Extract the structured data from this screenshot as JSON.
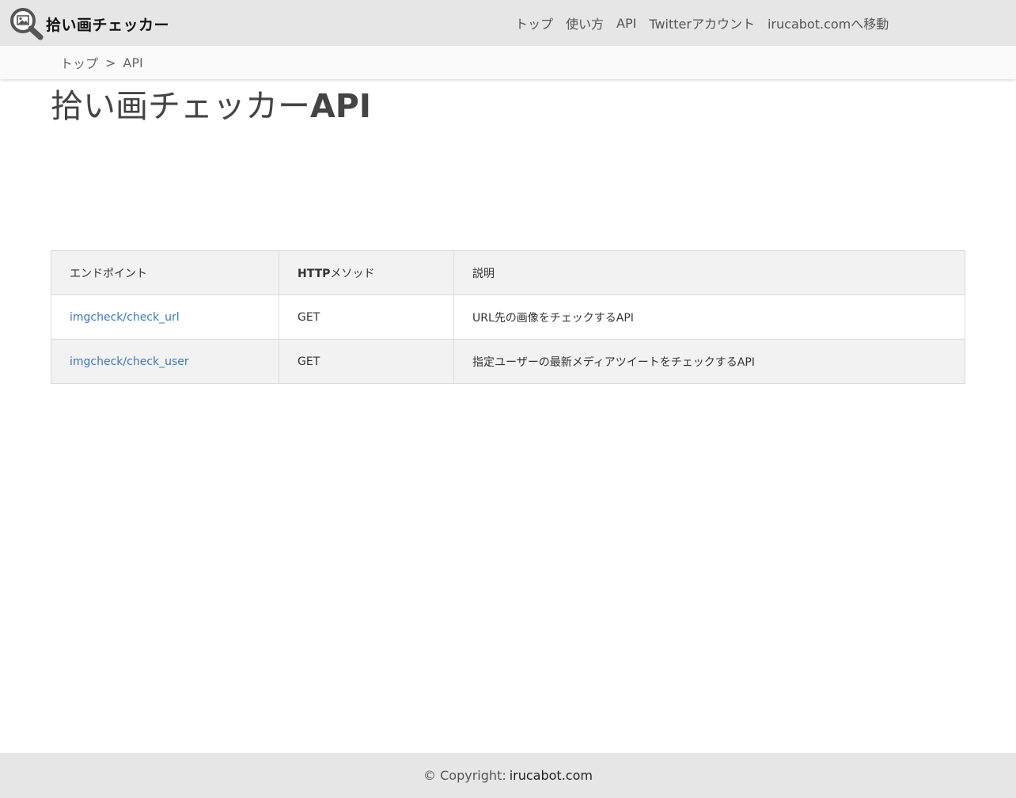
{
  "header": {
    "logo_text": "拾い画チェッカー",
    "logo_icon": "magnifier-image-icon",
    "nav": [
      {
        "label": "トップ"
      },
      {
        "label": "使い方"
      },
      {
        "label": "API"
      },
      {
        "label": "Twitterアカウント"
      },
      {
        "label": "irucabot.comへ移動"
      }
    ]
  },
  "breadcrumb": {
    "items": [
      "トップ",
      "API"
    ],
    "separator": ">"
  },
  "page": {
    "title_main": "拾い画チェッカー",
    "title_suffix": "API"
  },
  "table": {
    "headers": {
      "endpoint": "エンドポイント",
      "method_bold": "HTTP",
      "method_rest": "メソッド",
      "description": "説明"
    },
    "rows": [
      {
        "endpoint": "imgcheck/check_url",
        "method": "GET",
        "description": "URL先の画像をチェックするAPI"
      },
      {
        "endpoint": "imgcheck/check_user",
        "method": "GET",
        "description": "指定ユーザーの最新メディアツイートをチェックするAPI"
      }
    ]
  },
  "footer": {
    "copyright_label": "© Copyright:",
    "site_link": "irucabot.com"
  },
  "colors": {
    "header_bg": "#e6e6e6",
    "link": "#3b78c4",
    "text": "#444444"
  }
}
